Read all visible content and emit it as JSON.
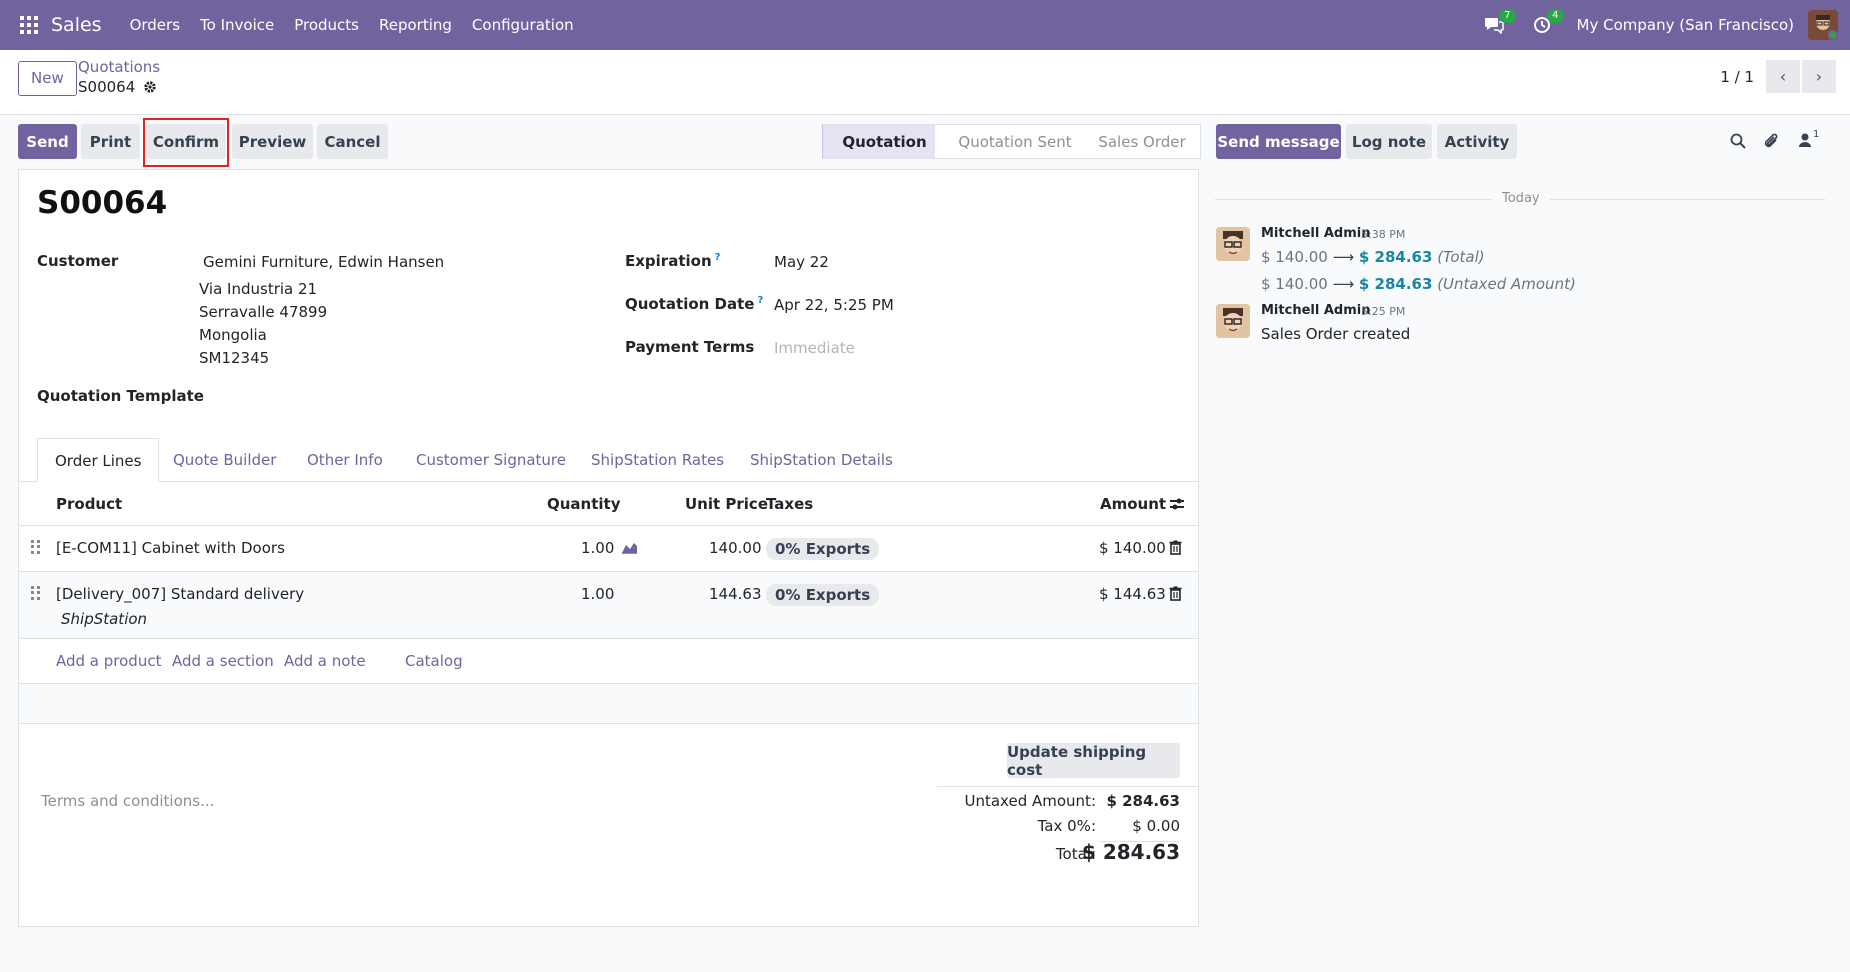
{
  "navbar": {
    "app_name": "Sales",
    "menu": [
      "Orders",
      "To Invoice",
      "Products",
      "Reporting",
      "Configuration"
    ],
    "messages_count": "7",
    "activities_count": "4",
    "company": "My Company (San Francisco)"
  },
  "control": {
    "new_label": "New",
    "breadcrumb_parent": "Quotations",
    "breadcrumb_current": "S00064",
    "pager": "1 / 1"
  },
  "actions": {
    "send": "Send",
    "print": "Print",
    "confirm": "Confirm",
    "preview": "Preview",
    "cancel": "Cancel"
  },
  "status": {
    "stages": [
      "Quotation",
      "Quotation Sent",
      "Sales Order"
    ],
    "active": "Quotation"
  },
  "form": {
    "title": "S00064",
    "customer_label": "Customer",
    "customer_name": "Gemini Furniture, Edwin Hansen",
    "address": [
      "Via Industria 21",
      "Serravalle 47899",
      "Mongolia",
      "SM12345"
    ],
    "expiration_label": "Expiration",
    "expiration_value": "May 22",
    "quotation_date_label": "Quotation Date",
    "quotation_date_value": "Apr 22, 5:25 PM",
    "payment_terms_label": "Payment Terms",
    "payment_terms_placeholder": "Immediate",
    "template_label": "Quotation Template",
    "help_mark": "?"
  },
  "tabs": [
    "Order Lines",
    "Quote Builder",
    "Other Info",
    "Customer Signature",
    "ShipStation Rates",
    "ShipStation Details"
  ],
  "table": {
    "headers": {
      "product": "Product",
      "quantity": "Quantity",
      "unit_price": "Unit Price",
      "taxes": "Taxes",
      "amount": "Amount"
    },
    "rows": [
      {
        "product": "[E-COM11] Cabinet with Doors",
        "note": "",
        "quantity": "1.00",
        "unit_price": "140.00",
        "tax": "0% Exports",
        "amount": "$ 140.00"
      },
      {
        "product": "[Delivery_007] Standard delivery",
        "note": "ShipStation",
        "quantity": "1.00",
        "unit_price": "144.63",
        "tax": "0% Exports",
        "amount": "$ 144.63"
      }
    ],
    "add_links": [
      "Add a product",
      "Add a section",
      "Add a note",
      "Catalog"
    ]
  },
  "footer": {
    "update_shipping": "Update shipping cost",
    "terms_placeholder": "Terms and conditions...",
    "untaxed_label": "Untaxed Amount:",
    "untaxed_value": "$ 284.63",
    "tax_label": "Tax 0%:",
    "tax_value": "$ 0.00",
    "total_label": "Total:",
    "total_value": "$ 284.63"
  },
  "chatter": {
    "send_message": "Send message",
    "log_note": "Log note",
    "activity": "Activity",
    "followers_count": "1",
    "today": "Today",
    "messages": [
      {
        "author": "Mitchell Admin",
        "time": "5:38 PM",
        "tracking": [
          {
            "old": "$ 140.00",
            "new": "$ 284.63",
            "field": "(Total)"
          },
          {
            "old": "$ 140.00",
            "new": "$ 284.63",
            "field": "(Untaxed Amount)"
          }
        ]
      },
      {
        "author": "Mitchell Admin",
        "time": "5:25 PM",
        "body": "Sales Order created"
      }
    ]
  },
  "colors": {
    "brand": "#71639e",
    "accent_teal": "#1787a1",
    "badge_green": "#28a745",
    "highlight_red": "#e02424"
  }
}
